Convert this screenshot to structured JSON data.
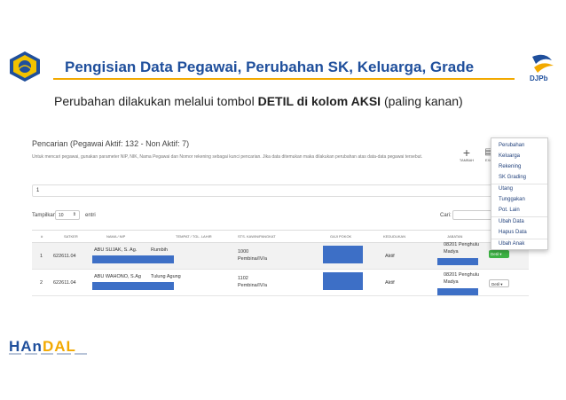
{
  "header": {
    "title": "Pengisian Data Pegawai, Perubahan SK, Keluarga, Grade",
    "right_logo_text": "DJPb",
    "subtitle_prefix": "Perubahan dilakukan melalui tombol",
    "subtitle_bold": "DETIL di kolom AKSI",
    "subtitle_suffix": "(paling kanan)"
  },
  "panel": {
    "title": "Pencarian (Pegawai Aktif: 132 - Non Aktif: 7)",
    "description": "Untuk mencari pegawai, gunakan parameter NIP, NIK, Nama Pegawai dan Nomor rekening sebagai kunci pencarian. Jika data ditemukan maka dilakukan perubahan atas data-data pegawai tersebut.",
    "add_label": "TAMBAH",
    "excel_label": "EXC",
    "search_value": "1",
    "show_label": "Tampilkan",
    "page_length": "10",
    "entries_label": "entri",
    "search_label": "Cari:"
  },
  "table": {
    "headers": [
      "#",
      "SATKER",
      "NAMA / NIP",
      "TEMPAT / TGL. LAHIR",
      "STS. KAWIN/PANGKAT",
      "GAJI POKOK",
      "KEDUDUKAN",
      "JABATAN"
    ],
    "rows": [
      {
        "no": "1",
        "satker": "622611.04",
        "nama": "ABU SUJAK, S. Ag.",
        "tempat": "Rumbih",
        "sts_line1": "1000",
        "sts_line2": "Pembina/IV/a",
        "kedudukan": "Aktif",
        "jab_line1": "08201 Penghulu",
        "jab_line2": "Madya",
        "aksi": "Detil ▾"
      },
      {
        "no": "2",
        "satker": "622611.04",
        "nama": "ABU WAHONO, S.Ag",
        "tempat": "Tulung Agung",
        "sts_line1": "1102",
        "sts_line2": "Pembina/IV/a",
        "kedudukan": "Aktif",
        "jab_line1": "08201 Penghulu",
        "jab_line2": "Madya",
        "aksi": "Detil ▾"
      }
    ]
  },
  "dropdown": {
    "items": [
      "Perubahan",
      "Keluarga",
      "Rekening",
      "SK Grading",
      "Utang",
      "Tunggakan",
      "Pot. Lain",
      "Ubah Data",
      "Hapus Data",
      "Ubah Anak"
    ]
  },
  "footer": {
    "brand_part1": "HAn",
    "brand_part2": "DAL"
  },
  "colors": {
    "title_blue": "#1f4f9c",
    "accent_gold": "#f2a900",
    "redaction_blue": "#3d6fc6",
    "detil_green": "#3db344"
  }
}
